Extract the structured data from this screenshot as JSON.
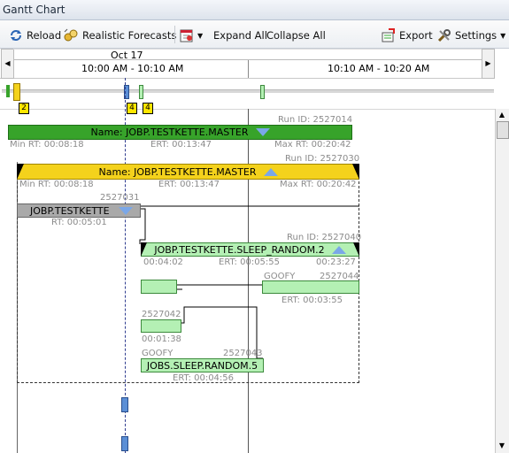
{
  "window": {
    "title": "Gantt Chart"
  },
  "toolbar": {
    "reload": "Reload",
    "forecasts": "Realistic Forecasts",
    "expand_all": "Expand All",
    "collapse_all": "Collapse All",
    "export": "Export",
    "settings": "Settings"
  },
  "timeline": {
    "date": "Oct 17",
    "slot1": "10:00 AM - 10:10 AM",
    "slot2": "10:10 AM - 10:20 AM"
  },
  "overview": {
    "badges": [
      "2",
      "4",
      "4"
    ]
  },
  "jobs": {
    "master_outer": {
      "run_id": "Run ID: 2527014",
      "name": "Name: JOBP.TESTKETTE.MASTER",
      "min_rt": "Min RT: 00:08:18",
      "ert": "ERT: 00:13:47",
      "max_rt": "Max RT: 00:20:42",
      "color": "#37a32a"
    },
    "master_inner": {
      "run_id": "Run ID: 2527030",
      "name": "Name: JOBP.TESTKETTE.MASTER",
      "min_rt": "Min RT: 00:08:18",
      "ert": "ERT: 00:13:47",
      "max_rt": "Max RT: 00:20:42",
      "color": "#f4d21c"
    },
    "kette": {
      "id": "2527031",
      "name": "JOBP.TESTKETTE",
      "rt": "RT: 00:05:01",
      "color": "#a9a9a9"
    },
    "sleep_random2": {
      "run_id": "Run ID: 2527040",
      "name": "JOBP.TESTKETTE.SLEEP_RANDOM.2",
      "start": "00:04:02",
      "ert": "ERT: 00:05:55",
      "end": "00:23:27",
      "color": "#b4f0b4"
    },
    "goofy1": {
      "host": "GOOFY",
      "id": "2527044",
      "ert": "ERT: 00:03:55"
    },
    "job_2527042": {
      "id": "2527042",
      "time": "00:01:38"
    },
    "sleep_random5": {
      "host": "GOOFY",
      "id": "2527043",
      "name": "JOBS.SLEEP.RANDOM.5",
      "ert": "ERT: 00:04:56"
    }
  }
}
